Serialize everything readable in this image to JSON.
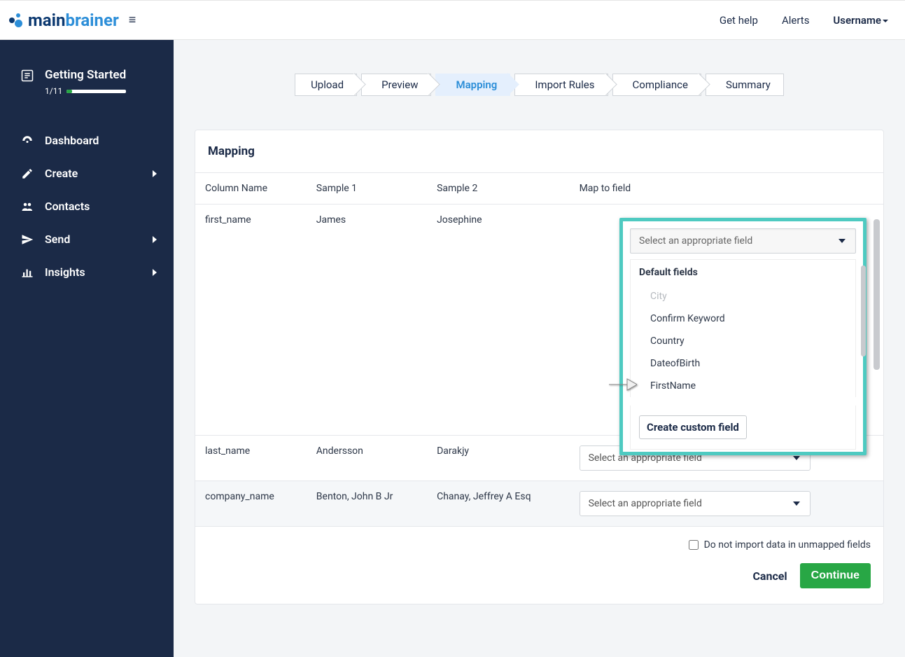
{
  "header": {
    "logo_main": "main",
    "logo_brainer": "brainer",
    "get_help": "Get help",
    "alerts": "Alerts",
    "username": "Username"
  },
  "sidebar": {
    "getting_started": {
      "title": "Getting Started",
      "progress_text": "1/11",
      "progress_pct": 9
    },
    "items": [
      {
        "label": "Dashboard",
        "has_arrow": false
      },
      {
        "label": "Create",
        "has_arrow": true
      },
      {
        "label": "Contacts",
        "has_arrow": false
      },
      {
        "label": "Send",
        "has_arrow": true
      },
      {
        "label": "Insights",
        "has_arrow": true
      }
    ]
  },
  "stepper": {
    "steps": [
      "Upload",
      "Preview",
      "Mapping",
      "Import Rules",
      "Compliance",
      "Summary"
    ],
    "active_index": 2
  },
  "card": {
    "title": "Mapping",
    "columns": [
      "Column Name",
      "Sample 1",
      "Sample 2",
      "Map to field"
    ],
    "rows": [
      {
        "name": "first_name",
        "s1": "James",
        "s2": "Josephine"
      },
      {
        "name": "last_name",
        "s1": "Andersson",
        "s2": "Darakjy"
      },
      {
        "name": "company_name",
        "s1": "Benton, John B Jr",
        "s2": "Chanay, Jeffrey A Esq"
      }
    ],
    "select_placeholder": "Select an appropriate field"
  },
  "dropdown": {
    "group_label": "Default fields",
    "options": [
      {
        "label": "City",
        "disabled": true
      },
      {
        "label": "Confirm Keyword",
        "disabled": false
      },
      {
        "label": "Country",
        "disabled": false
      },
      {
        "label": "DateofBirth",
        "disabled": false
      },
      {
        "label": "FirstName",
        "disabled": false
      }
    ],
    "create_custom": "Create custom field"
  },
  "footer": {
    "checkbox_label": "Do not import data in unmapped fields",
    "cancel": "Cancel",
    "continue": "Continue"
  }
}
